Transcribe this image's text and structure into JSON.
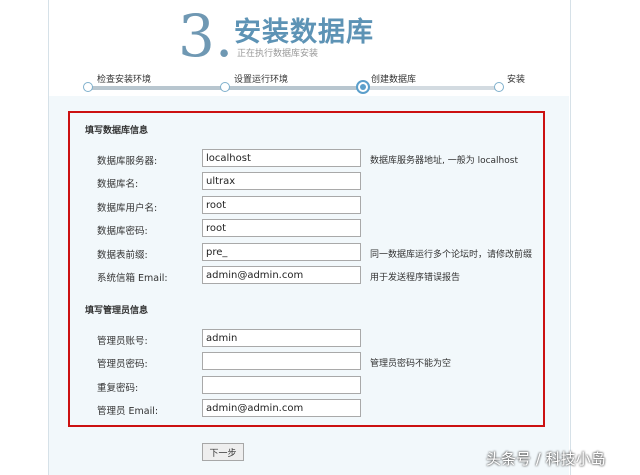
{
  "header": {
    "step_number": "3.",
    "title": "安装数据库",
    "subtitle": "正在执行数据库安装"
  },
  "steps": [
    {
      "label": "检查安装环境",
      "state": "done"
    },
    {
      "label": "设置运行环境",
      "state": "done"
    },
    {
      "label": "创建数据库",
      "state": "active"
    },
    {
      "label": "安装",
      "state": "pending"
    }
  ],
  "db_section": {
    "title": "填写数据库信息",
    "fields": [
      {
        "label": "数据库服务器:",
        "value": "localhost",
        "hint": "数据库服务器地址, 一般为 localhost"
      },
      {
        "label": "数据库名:",
        "value": "ultrax",
        "hint": ""
      },
      {
        "label": "数据库用户名:",
        "value": "root",
        "hint": ""
      },
      {
        "label": "数据库密码:",
        "value": "root",
        "hint": ""
      },
      {
        "label": "数据表前缀:",
        "value": "pre_",
        "hint": "同一数据库运行多个论坛时，请修改前缀"
      },
      {
        "label": "系统信箱 Email:",
        "value": "admin@admin.com",
        "hint": "用于发送程序错误报告"
      }
    ]
  },
  "admin_section": {
    "title": "填写管理员信息",
    "fields": [
      {
        "label": "管理员账号:",
        "value": "admin",
        "hint": ""
      },
      {
        "label": "管理员密码:",
        "value": "",
        "hint": "管理员密码不能为空"
      },
      {
        "label": "重复密码:",
        "value": "",
        "hint": ""
      },
      {
        "label": "管理员 Email:",
        "value": "admin@admin.com",
        "hint": ""
      }
    ]
  },
  "next_button_label": "下一步",
  "watermark": "头条号 / 科技小岛",
  "colors": {
    "accent": "#5d93b5",
    "highlight_border": "#cc1111"
  }
}
